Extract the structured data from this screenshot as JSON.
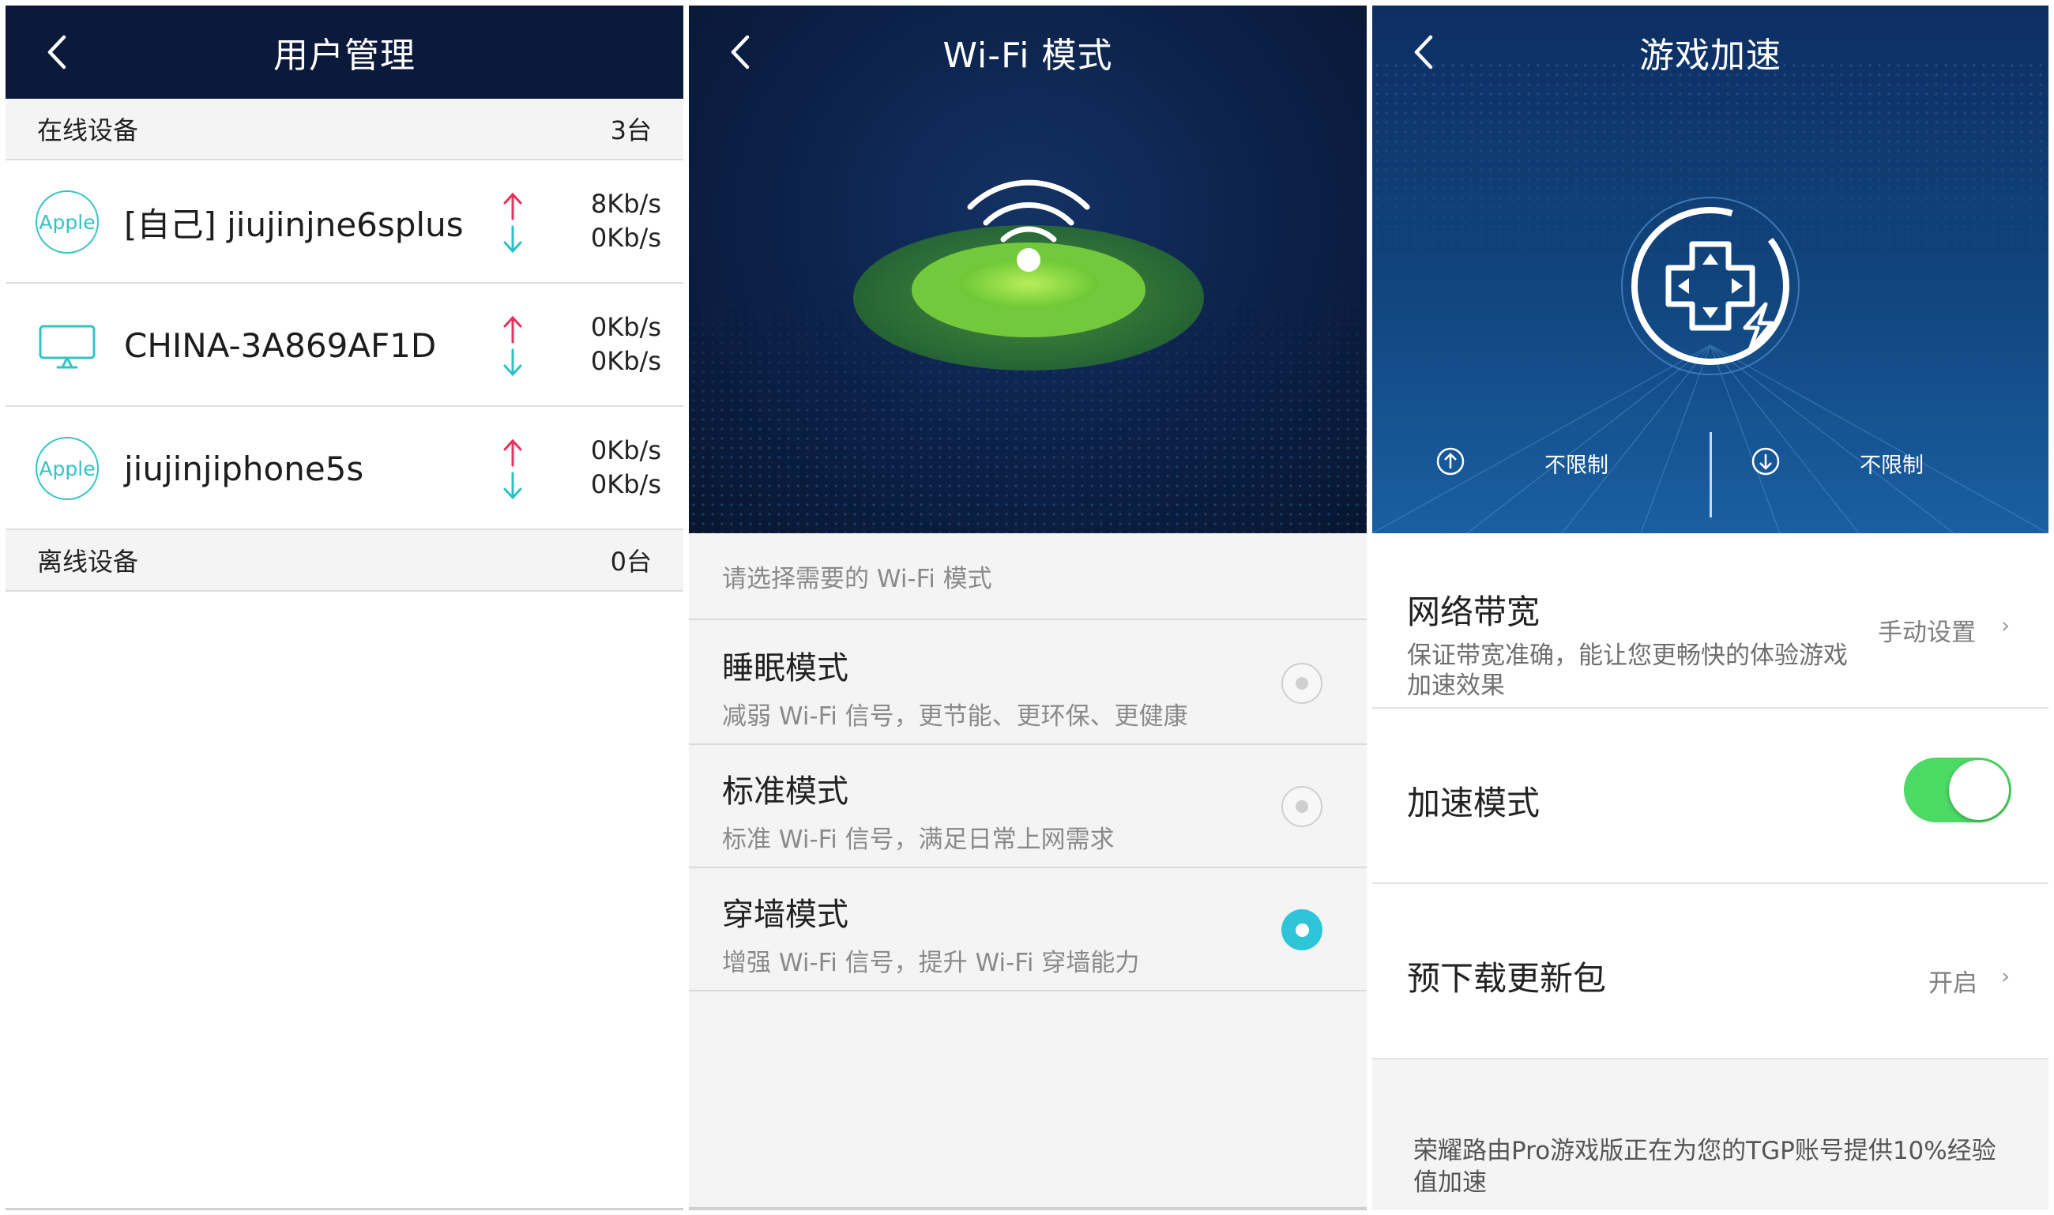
{
  "user_mgmt": {
    "title": "用户管理",
    "online_label": "在线设备",
    "online_count": "3台",
    "offline_label": "离线设备",
    "offline_count": "0台",
    "devices": [
      {
        "icon": "apple-icon",
        "icon_text": "Apple",
        "name": "[自己] jiujinjne6splus",
        "up": "8Kb/s",
        "down": "0Kb/s"
      },
      {
        "icon": "monitor-icon",
        "icon_text": "",
        "name": "CHINA-3A869AF1D",
        "up": "0Kb/s",
        "down": "0Kb/s"
      },
      {
        "icon": "apple-icon",
        "icon_text": "Apple",
        "name": "jiujinjiphone5s",
        "up": "0Kb/s",
        "down": "0Kb/s"
      }
    ],
    "colors": {
      "header": "#0b1a3a",
      "up_arrow": "#e8315b",
      "down_arrow": "#2cc1c7",
      "apple": "#32c3c6"
    }
  },
  "wifi_mode": {
    "title": "Wi-Fi 模式",
    "hint": "请选择需要的 Wi-Fi 模式",
    "modes": [
      {
        "name": "睡眠模式",
        "desc": "减弱 Wi-Fi 信号，更节能、更环保、更健康",
        "selected": false
      },
      {
        "name": "标准模式",
        "desc": "标准 Wi-Fi 信号，满足日常上网需求",
        "selected": false
      },
      {
        "name": "穿墙模式",
        "desc": "增强 Wi-Fi 信号，提升 Wi-Fi 穿墙能力",
        "selected": true
      }
    ],
    "colors": {
      "radio_on": "#2fc5d9",
      "signal_green": "#7ad33a"
    }
  },
  "game_accel": {
    "title": "游戏加速",
    "upload_limit": "不限制",
    "download_limit": "不限制",
    "bandwidth": {
      "label": "网络带宽",
      "desc": "保证带宽准确，能让您更畅快的体验游戏加速效果",
      "value": "手动设置"
    },
    "accel_mode": {
      "label": "加速模式",
      "enabled": true
    },
    "predownload": {
      "label": "预下载更新包",
      "value": "开启"
    },
    "note": "荣耀路由Pro游戏版正在为您的TGP账号提供10%经验值加速",
    "colors": {
      "toggle_on": "#4cd964"
    }
  },
  "icons": [
    "back-chevron-icon",
    "wifi-signal-icon",
    "gamepad-icon",
    "upload-icon",
    "download-icon",
    "chevron-right-icon"
  ]
}
